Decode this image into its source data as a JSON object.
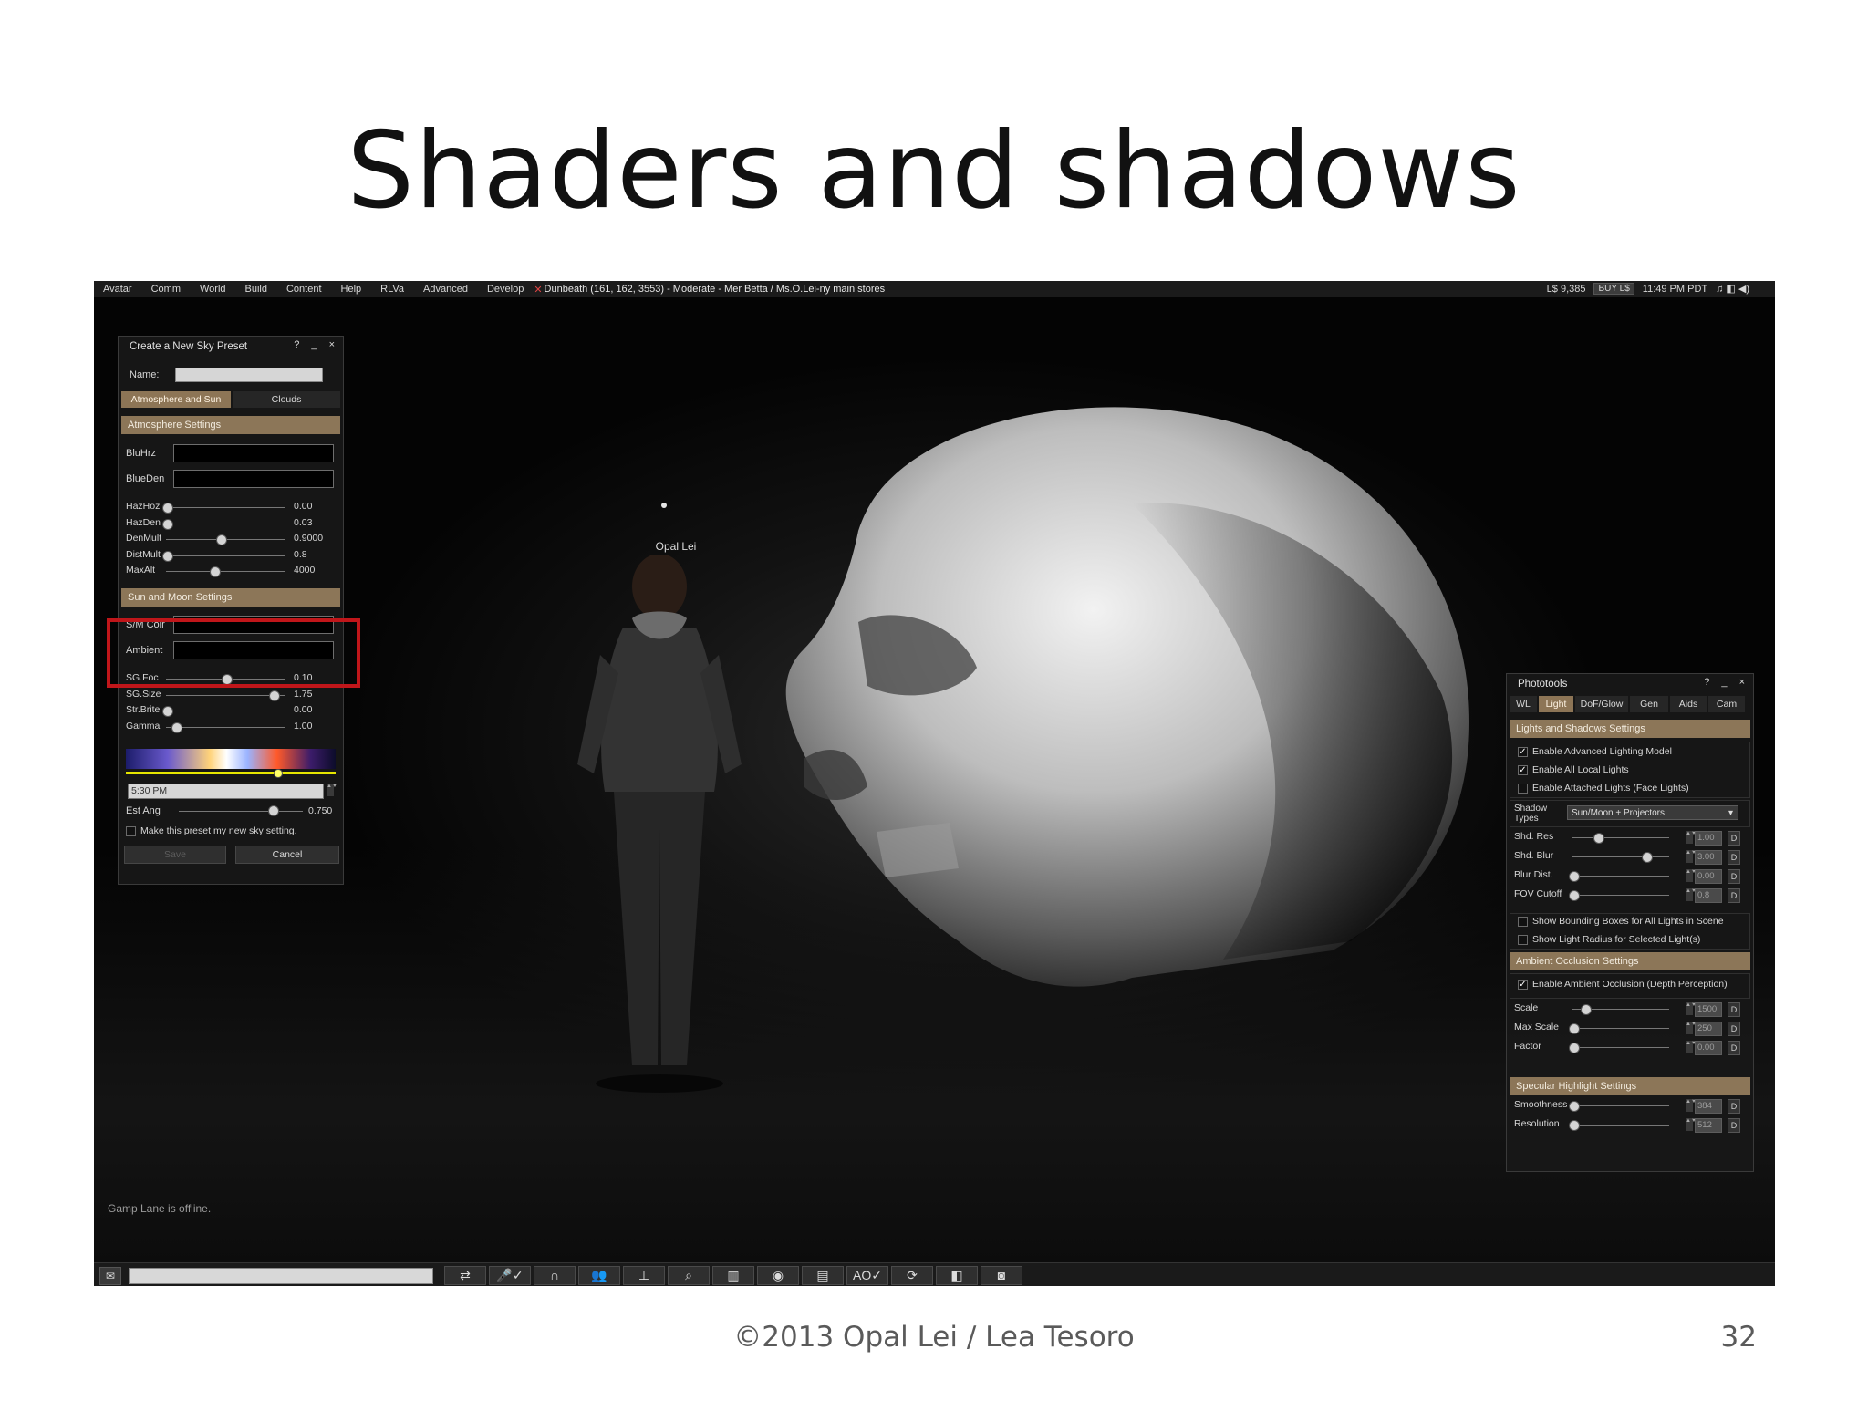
{
  "slide": {
    "title": "Shaders and shadows",
    "footer": "©2013 Opal Lei / Lea Tesoro",
    "page_number": "32"
  },
  "menubar": {
    "items": [
      "Avatar",
      "Comm",
      "World",
      "Build",
      "Content",
      "Help",
      "RLVa",
      "Advanced",
      "Develop"
    ],
    "location": "Dunbeath (161, 162, 3553) - Moderate - Mer Betta / Ms.O.Lei-ny main stores",
    "balance": "L$ 9,385",
    "buy_label": "BUY L$",
    "time": "11:49 PM PDT",
    "media_icons": "♫ ◧ ◀)"
  },
  "scene": {
    "avatar_name": "Opal Lei",
    "notice": "Gamp Lane is offline."
  },
  "sky_panel": {
    "title": "Create a New Sky Preset",
    "controls": "? _ ×",
    "name_label": "Name:",
    "tabs": [
      "Atmosphere and Sun",
      "Clouds"
    ],
    "atmosphere_header": "Atmosphere Settings",
    "color_fields": [
      "BluHrz",
      "BlueDen"
    ],
    "sliders1": [
      {
        "label": "HazHoz",
        "value": "0.00",
        "fraction": 0.0
      },
      {
        "label": "HazDen",
        "value": "0.03",
        "fraction": 0.0
      },
      {
        "label": "DenMult",
        "value": "0.9000",
        "fraction": 0.45
      },
      {
        "label": "DistMult",
        "value": "0.8",
        "fraction": 0.0
      },
      {
        "label": "MaxAlt",
        "value": "4000",
        "fraction": 0.4
      }
    ],
    "sun_header": "Sun and Moon Settings",
    "sun_fields": [
      "S/M Colr",
      "Ambient"
    ],
    "sliders2": [
      {
        "label": "SG.Foc",
        "value": "0.10",
        "fraction": 0.5
      },
      {
        "label": "SG.Size",
        "value": "1.75",
        "fraction": 0.9
      },
      {
        "label": "Str.Brite",
        "value": "0.00",
        "fraction": 0.0
      },
      {
        "label": "Gamma",
        "value": "1.00",
        "fraction": 0.08
      }
    ],
    "time_value": "5:30 PM",
    "est_ang_label": "Est Ang",
    "est_ang_value": "0.750",
    "est_ang_fraction": 0.75,
    "default_checkbox": "Make this preset my new sky setting.",
    "save_label": "Save",
    "cancel_label": "Cancel"
  },
  "phototools": {
    "title": "Phototools",
    "controls": "? _ ×",
    "tabs": [
      "WL",
      "Light",
      "DoF/Glow",
      "Gen",
      "Aids",
      "Cam"
    ],
    "lights_header": "Lights and Shadows Settings",
    "lights_checks": [
      {
        "label": "Enable Advanced Lighting Model",
        "checked": true
      },
      {
        "label": "Enable All Local Lights",
        "checked": true
      },
      {
        "label": "Enable Attached Lights (Face Lights)",
        "checked": false
      }
    ],
    "shadow_types_label": "Shadow Types",
    "shadow_types_value": "Sun/Moon + Projectors",
    "shadow_sliders": [
      {
        "label": "Shd. Res",
        "value": "1.00",
        "fraction": 0.25
      },
      {
        "label": "Shd. Blur",
        "value": "3.00",
        "fraction": 0.75
      },
      {
        "label": "Blur Dist.",
        "value": "0.00",
        "fraction": 0.0
      },
      {
        "label": "FOV Cutoff",
        "value": "0.8",
        "fraction": 0.0
      }
    ],
    "debug_checks": [
      {
        "label": "Show Bounding Boxes for All Lights in Scene",
        "checked": false
      },
      {
        "label": "Show Light Radius for Selected Light(s)",
        "checked": false
      }
    ],
    "ao_header": "Ambient Occlusion Settings",
    "ao_check": {
      "label": "Enable Ambient Occlusion (Depth Perception)",
      "checked": true
    },
    "ao_sliders": [
      {
        "label": "Scale",
        "value": "1500",
        "fraction": 0.12
      },
      {
        "label": "Max Scale",
        "value": "250",
        "fraction": 0.0
      },
      {
        "label": "Factor",
        "value": "0.00",
        "fraction": 0.0
      }
    ],
    "spec_header": "Specular Highlight Settings",
    "spec_sliders": [
      {
        "label": "Smoothness",
        "value": "384",
        "fraction": 0.0
      },
      {
        "label": "Resolution",
        "value": "512",
        "fraction": 0.0
      }
    ],
    "d_label": "D"
  },
  "bottombar": {
    "chat_icon": "speech-bubble-icon",
    "buttons": [
      "⇄",
      "🎤✓",
      "∩",
      "👥",
      "⊥",
      "⌕",
      "▥",
      "◉",
      "▤",
      "AO✓",
      "⟳",
      "◧",
      "◙"
    ]
  }
}
